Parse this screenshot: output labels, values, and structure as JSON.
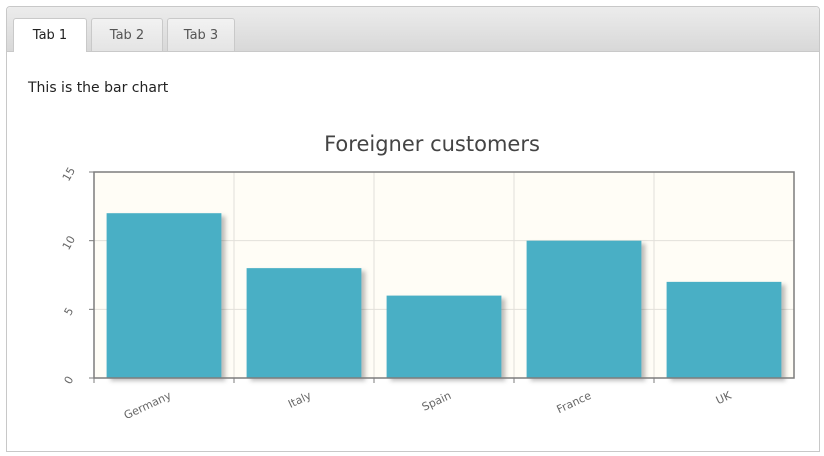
{
  "tabs": [
    {
      "label": "Tab 1",
      "active": true
    },
    {
      "label": "Tab 2",
      "active": false
    },
    {
      "label": "Tab 3",
      "active": false
    }
  ],
  "intro_text": "This is the bar chart",
  "colors": {
    "bar": "#4aafc5",
    "plot_bg": "#fffdf6",
    "grid": "#e2e0da"
  },
  "chart_data": {
    "type": "bar",
    "title": "Foreigner customers",
    "categories": [
      "Germany",
      "Italy",
      "Spain",
      "France",
      "UK"
    ],
    "values": [
      12,
      8,
      6,
      10,
      7
    ],
    "ylim": [
      0,
      15
    ],
    "yticks": [
      0,
      5,
      10,
      15
    ],
    "grid": true,
    "xlabel": "",
    "ylabel": ""
  }
}
